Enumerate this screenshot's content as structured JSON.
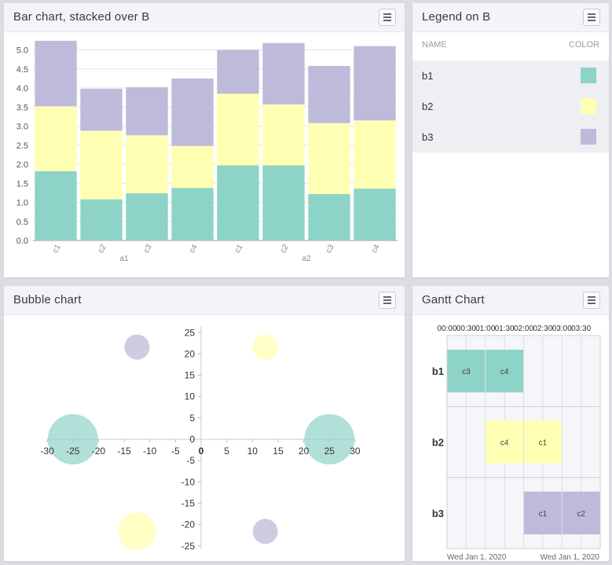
{
  "panels": {
    "bar": {
      "title": "Bar chart, stacked over B"
    },
    "legend": {
      "title": "Legend on B",
      "col_name": "NAME",
      "col_color": "COLOR"
    },
    "bubble": {
      "title": "Bubble chart"
    },
    "gantt": {
      "title": "Gantt Chart"
    }
  },
  "colors": {
    "b1": "#8ed3c7",
    "b2": "#ffffb3",
    "b3": "#bebada"
  },
  "legend_items": [
    {
      "name": "b1",
      "color": "#8ed3c7"
    },
    {
      "name": "b2",
      "color": "#ffffb3"
    },
    {
      "name": "b3",
      "color": "#bebada"
    }
  ],
  "chart_data": [
    {
      "type": "bar",
      "stacked": true,
      "title": "Bar chart, stacked over B",
      "categories": [
        "c1",
        "c2",
        "c3",
        "c4",
        "c1",
        "c2",
        "c3",
        "c4"
      ],
      "groups": [
        {
          "label": "a1",
          "count": 4
        },
        {
          "label": "a2",
          "count": 4
        }
      ],
      "series": [
        {
          "name": "b1",
          "values": [
            1.82,
            1.08,
            1.24,
            1.38,
            1.97,
            1.97,
            1.22,
            1.36
          ]
        },
        {
          "name": "b2",
          "values": [
            1.7,
            1.8,
            1.52,
            1.1,
            1.88,
            1.6,
            1.86,
            1.79
          ]
        },
        {
          "name": "b3",
          "values": [
            1.72,
            1.1,
            1.26,
            1.77,
            1.15,
            1.61,
            1.5,
            1.95
          ]
        }
      ],
      "ylim": [
        0,
        5.3
      ],
      "yticks": [
        "0.0",
        "0.5",
        "1.0",
        "1.5",
        "2.0",
        "2.5",
        "3.0",
        "3.5",
        "4.0",
        "4.5",
        "5.0"
      ],
      "grid": true
    },
    {
      "type": "scatter",
      "subtype": "bubble",
      "title": "Bubble chart",
      "xlim": [
        -30,
        30
      ],
      "ylim": [
        -25,
        25
      ],
      "xticks": [
        "-30",
        "-25",
        "-20",
        "-15",
        "-10",
        "-5",
        "0",
        "5",
        "10",
        "15",
        "20",
        "25",
        "30"
      ],
      "yticks": [
        "25",
        "20",
        "15",
        "10",
        "5",
        "0",
        "-5",
        "-10",
        "-15",
        "-20",
        "-25"
      ],
      "points": [
        {
          "x": -12.5,
          "y": 21.6,
          "size": 1,
          "series": "b3"
        },
        {
          "x": 12.5,
          "y": 21.6,
          "size": 1,
          "series": "b2"
        },
        {
          "x": -25,
          "y": 0,
          "size": 2,
          "series": "b1"
        },
        {
          "x": 25,
          "y": 0,
          "size": 2,
          "series": "b1"
        },
        {
          "x": -12.5,
          "y": -21.6,
          "size": 1.5,
          "series": "b2"
        },
        {
          "x": 12.5,
          "y": -21.6,
          "size": 1,
          "series": "b3"
        }
      ]
    },
    {
      "type": "gantt",
      "title": "Gantt Chart",
      "time_ticks": [
        "00:00",
        "00:30",
        "01:00",
        "01:30",
        "02:00",
        "02:30",
        "03:00",
        "03:30"
      ],
      "date_labels": [
        "Wed Jan 1, 2020",
        "Wed Jan 1, 2020"
      ],
      "rows": [
        {
          "name": "b1",
          "tasks": [
            {
              "label": "c3",
              "start": 0,
              "end": 1
            },
            {
              "label": "c4",
              "start": 1,
              "end": 2
            }
          ]
        },
        {
          "name": "b2",
          "tasks": [
            {
              "label": "c4",
              "start": 1,
              "end": 2
            },
            {
              "label": "c1",
              "start": 2,
              "end": 3
            }
          ]
        },
        {
          "name": "b3",
          "tasks": [
            {
              "label": "c1",
              "start": 2,
              "end": 3
            },
            {
              "label": "c2",
              "start": 3,
              "end": 4
            }
          ]
        }
      ]
    }
  ]
}
